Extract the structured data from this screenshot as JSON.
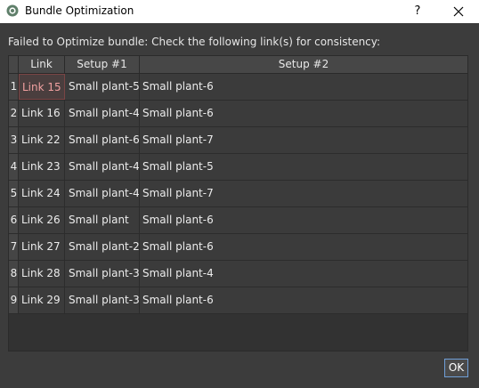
{
  "window": {
    "title": "Bundle Optimization",
    "help_label": "?",
    "close_icon": "close-icon",
    "app_icon": "app-logo-icon"
  },
  "message": "Failed to Optimize bundle: Check the following link(s) for consistency:",
  "table": {
    "headers": {
      "link": "Link",
      "setup1": "Setup #1",
      "setup2": "Setup #2"
    },
    "rows": [
      {
        "num": "1",
        "link": "Link 15",
        "setup1": "Small plant-5",
        "setup2": "Small plant-6"
      },
      {
        "num": "2",
        "link": "Link 16",
        "setup1": "Small plant-4",
        "setup2": "Small plant-6"
      },
      {
        "num": "3",
        "link": "Link 22",
        "setup1": "Small plant-6",
        "setup2": "Small plant-7"
      },
      {
        "num": "4",
        "link": "Link 23",
        "setup1": "Small plant-4",
        "setup2": "Small plant-5"
      },
      {
        "num": "5",
        "link": "Link 24",
        "setup1": "Small plant-4",
        "setup2": "Small plant-7"
      },
      {
        "num": "6",
        "link": "Link 26",
        "setup1": "Small plant",
        "setup2": "Small plant-6"
      },
      {
        "num": "7",
        "link": "Link 27",
        "setup1": "Small plant-2",
        "setup2": "Small plant-6"
      },
      {
        "num": "8",
        "link": "Link 28",
        "setup1": "Small plant-3",
        "setup2": "Small plant-4"
      },
      {
        "num": "9",
        "link": "Link 29",
        "setup1": "Small plant-3",
        "setup2": "Small plant-6"
      }
    ]
  },
  "buttons": {
    "ok": "OK"
  },
  "colors": {
    "background": "#3c3c3c",
    "titlebar": "#ffffff",
    "selected_text": "#f0a0a0",
    "ok_border": "#6f9fd8"
  }
}
